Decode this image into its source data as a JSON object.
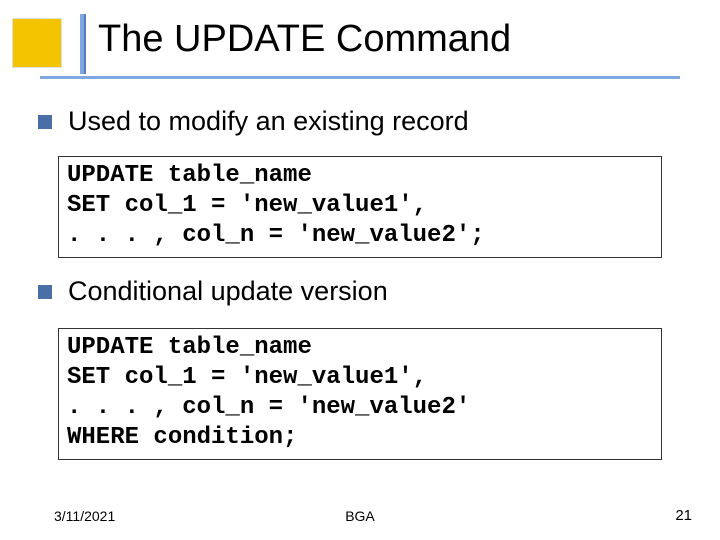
{
  "title": "The UPDATE Command",
  "bullets": [
    "Used to modify an existing record",
    "Conditional update version"
  ],
  "code_blocks": [
    [
      "UPDATE table_name",
      "SET col_1 = 'new_value1',",
      ". . . , col_n = 'new_value2';"
    ],
    [
      "UPDATE table_name",
      "SET col_1 = 'new_value1',",
      ". . . , col_n = 'new_value2'",
      "WHERE condition;"
    ]
  ],
  "footer": {
    "date": "3/11/2021",
    "center": "BGA",
    "page": "21"
  }
}
